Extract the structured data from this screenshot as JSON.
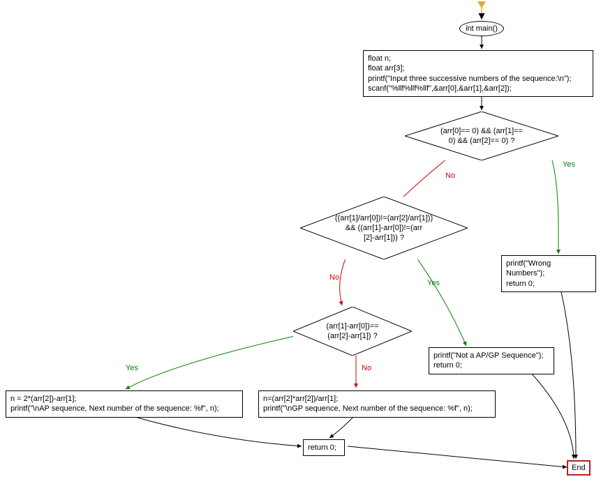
{
  "chart_data": {
    "type": "flowchart",
    "nodes": [
      {
        "id": "start",
        "kind": "start"
      },
      {
        "id": "main",
        "kind": "terminal",
        "text": "int main()"
      },
      {
        "id": "init",
        "kind": "process",
        "text": "float n;\nfloat arr[3];\nprintf(\"Input three successive numbers of the sequence:\\n\");\nscanf(\"%llf%llf%llf\",&arr[0],&arr[1],&arr[2]);"
      },
      {
        "id": "d1",
        "kind": "decision",
        "text": "(arr[0]== 0) && (arr[1]== 0) && (arr[2]== 0) ?"
      },
      {
        "id": "wrong",
        "kind": "process",
        "text": "printf(\"Wrong Numbers\");\nreturn 0;"
      },
      {
        "id": "d2",
        "kind": "decision",
        "text": "((arr[1]/arr[0])!=(arr[2]/arr[1])) && ((arr[1]-arr[0])!=(arr[2]-arr[1])) ?"
      },
      {
        "id": "notap",
        "kind": "process",
        "text": "printf(\"Not a AP/GP Sequence\");\nreturn 0;"
      },
      {
        "id": "d3",
        "kind": "decision",
        "text": "(arr[1]-arr[0])==(arr[2]-arr[1]) ?"
      },
      {
        "id": "ap",
        "kind": "process",
        "text": "n = 2*(arr[2])-arr[1];\nprintf(\"\\nAP sequence, Next number of the sequence: %f\", n);"
      },
      {
        "id": "gp",
        "kind": "process",
        "text": "n=(arr[2]*arr[2])/arr[1];\nprintf(\"\\nGP sequence, Next number of the sequence: %f\", n);"
      },
      {
        "id": "ret0",
        "kind": "process",
        "text": "return 0;"
      },
      {
        "id": "end",
        "kind": "end",
        "text": "End"
      }
    ],
    "edges": [
      {
        "from": "start",
        "to": "main"
      },
      {
        "from": "main",
        "to": "init"
      },
      {
        "from": "init",
        "to": "d1"
      },
      {
        "from": "d1",
        "to": "wrong",
        "label": "Yes"
      },
      {
        "from": "d1",
        "to": "d2",
        "label": "No"
      },
      {
        "from": "d2",
        "to": "notap",
        "label": "Yes"
      },
      {
        "from": "d2",
        "to": "d3",
        "label": "No"
      },
      {
        "from": "d3",
        "to": "ap",
        "label": "Yes"
      },
      {
        "from": "d3",
        "to": "gp",
        "label": "No"
      },
      {
        "from": "ap",
        "to": "ret0"
      },
      {
        "from": "gp",
        "to": "ret0"
      },
      {
        "from": "ret0",
        "to": "end"
      },
      {
        "from": "wrong",
        "to": "end"
      },
      {
        "from": "notap",
        "to": "end"
      }
    ]
  },
  "labels": {
    "main": "int main()",
    "init_l1": "float n;",
    "init_l2": "float arr[3];",
    "init_l3": "printf(\"Input three successive numbers of the sequence:\\n\");",
    "init_l4": "scanf(\"%llf%llf%llf\",&arr[0],&arr[1],&arr[2]);",
    "d1_l1": "(arr[0]== 0) && (arr[1]==",
    "d1_l2": "0) && (arr[2]== 0) ?",
    "wrong_l1": "printf(\"Wrong Numbers\");",
    "wrong_l2": "return 0;",
    "d2_l1": "((arr[1]/arr[0])!=(arr[2]/arr[1]))",
    "d2_l2": "&& ((arr[1]-arr[0])!=(arr",
    "d2_l3": "[2]-arr[1])) ?",
    "notap_l1": "printf(\"Not a AP/GP Sequence\");",
    "notap_l2": "return 0;",
    "d3_l1": "(arr[1]-arr[0])==",
    "d3_l2": "(arr[2]-arr[1]) ?",
    "ap_l1": "n = 2*(arr[2])-arr[1];",
    "ap_l2": "printf(\"\\nAP sequence, Next number of the sequence: %f\", n);",
    "gp_l1": "n=(arr[2]*arr[2])/arr[1];",
    "gp_l2": "printf(\"\\nGP sequence, Next number of the sequence: %f\", n);",
    "ret0": "return 0;",
    "end": "End",
    "yes": "Yes",
    "no": "No"
  }
}
